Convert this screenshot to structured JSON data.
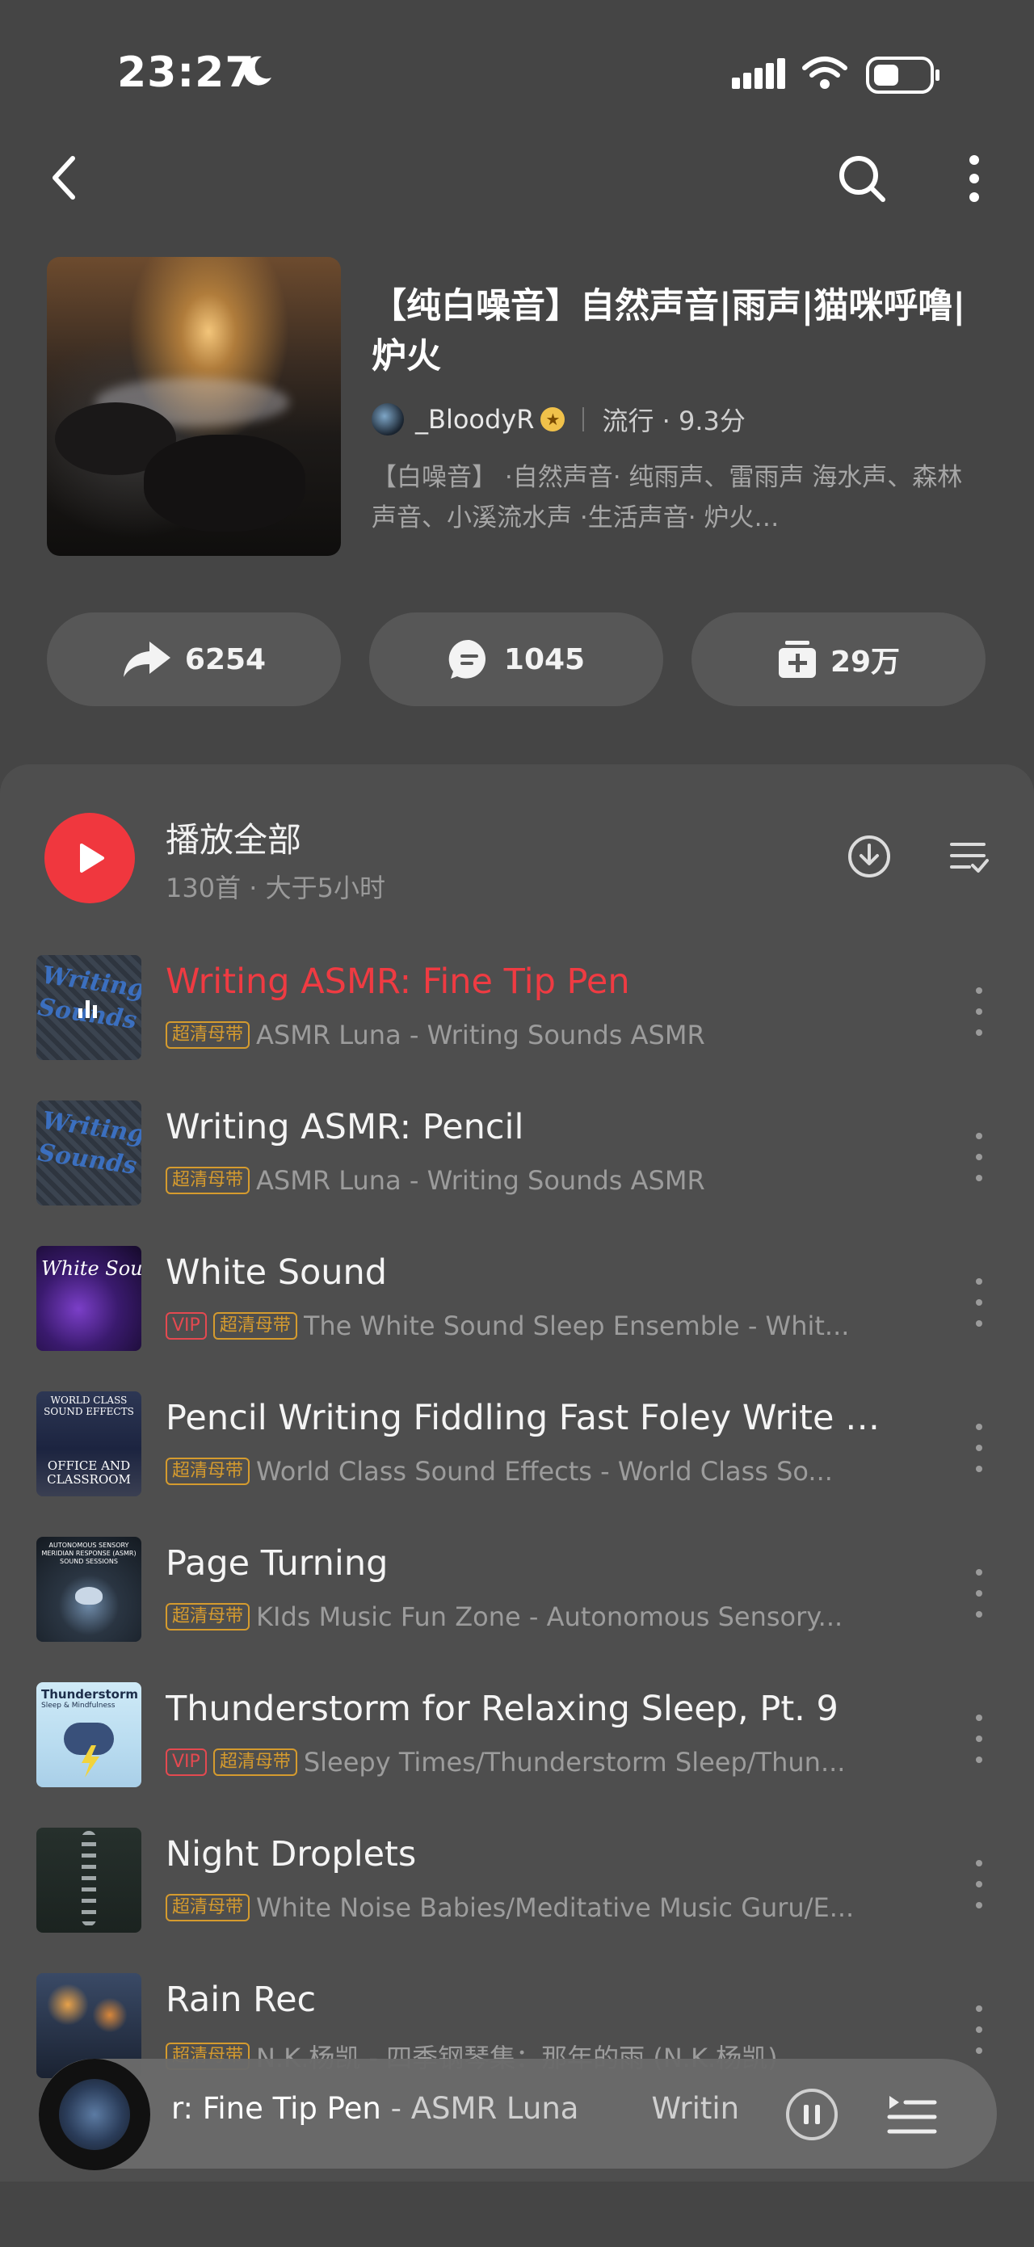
{
  "status_bar": {
    "time": "23:27"
  },
  "playlist": {
    "title": "【纯白噪音】自然声音|雨声|猫咪呼噜|炉火",
    "creator": "_BloodyR",
    "genre_rating": "流行 · 9.3分",
    "description": "【白噪音】 ·自然声音· 纯雨声、雷雨声 海水声、森林声音、小溪流水声 ·生活声音· 炉火…"
  },
  "actions": {
    "share_count": "6254",
    "comment_count": "1045",
    "collect_count": "29万"
  },
  "list_header": {
    "play_all_label": "播放全部",
    "meta": "130首 · 大于5小时"
  },
  "songs": [
    {
      "title": "Writing ASMR: Fine Tip Pen",
      "tags": [
        "超清母带"
      ],
      "artist": "ASMR Luna - Writing Sounds ASMR",
      "playing": true
    },
    {
      "title": "Writing ASMR: Pencil",
      "tags": [
        "超清母带"
      ],
      "artist": "ASMR Luna - Writing Sounds ASMR"
    },
    {
      "title": "White Sound",
      "tags": [
        "VIP",
        "超清母带"
      ],
      "artist": "The White Sound Sleep Ensemble - Whit..."
    },
    {
      "title": "Pencil Writing Fiddling Fast Foley Write S...",
      "tags": [
        "超清母带"
      ],
      "artist": "World Class Sound Effects - World Class So..."
    },
    {
      "title": "Page Turning",
      "tags": [
        "超清母带"
      ],
      "artist": "KIds Music Fun Zone - Autonomous Sensory..."
    },
    {
      "title": "Thunderstorm for Relaxing Sleep, Pt. 9",
      "tags": [
        "VIP",
        "超清母带"
      ],
      "artist": "Sleepy Times/Thunderstorm Sleep/Thun..."
    },
    {
      "title": "Night Droplets",
      "tags": [
        "超清母带"
      ],
      "artist": "White Noise Babies/Meditative Music Guru/E..."
    },
    {
      "title": "Rain Rec",
      "tags": [
        "超清母带"
      ],
      "artist": "N.K.杨凯 - 四季钢琴集：那年的雨 (N.K.杨凯)"
    }
  ],
  "art_labels": {
    "writing": "Writing Sounds",
    "white_sound": "White Sound",
    "world_class": "WORLD CLASS SOUND EFFECTS",
    "office": "OFFICE AND CLASSROOM",
    "autonomous": "AUTONOMOUS SENSORY MERIDIAN RESPONSE (ASMR) SOUND SESSIONS",
    "thunderstorm": "Thunderstorm",
    "thunder_sub": "Sleep & Mindfulness"
  },
  "mini_player": {
    "scroll_prefix": "r: Fine Tip Pen",
    "artist": " - ASMR Luna",
    "scroll_next": "Writin"
  },
  "colors": {
    "accent": "#ef3b42",
    "tag_hq": "#d59b2e",
    "background": "#454545"
  }
}
